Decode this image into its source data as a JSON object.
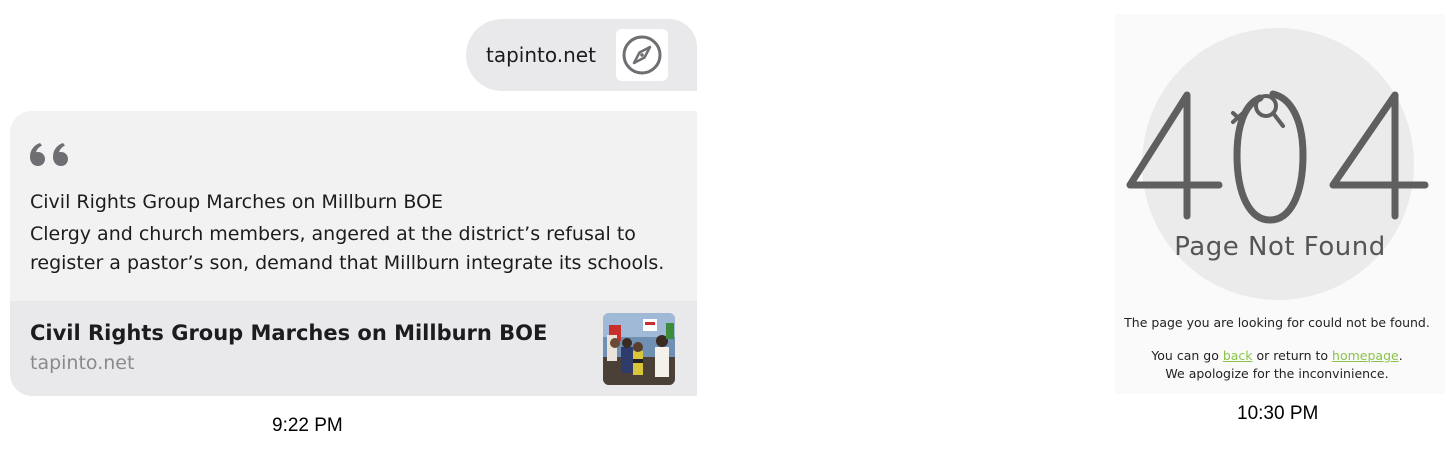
{
  "message_url": {
    "domain": "tapinto.net",
    "icon": "compass-icon"
  },
  "quote_card": {
    "quote_icon": "quote-mark-icon",
    "title": "Civil Rights Group Marches on Millburn BOE",
    "body": "Clergy and church members, angered at the district’s refusal to register a pastor’s son, demand that Millburn integrate its schools.",
    "link_title": "Civil Rights Group Marches on Millburn BOE",
    "link_domain": "tapinto.net"
  },
  "left_timestamp": "9:22 PM",
  "error_page": {
    "code": "404",
    "title": "Page Not Found",
    "description": "The page you are looking for could not be found.",
    "nav_prefix": "You can go",
    "back_link": "back",
    "nav_middle": "or return to",
    "home_link": "homepage",
    "nav_suffix": ".",
    "apology": "We apologize for the inconvinience.",
    "link_color": "#8bc34a"
  },
  "right_timestamp": "10:30 PM"
}
